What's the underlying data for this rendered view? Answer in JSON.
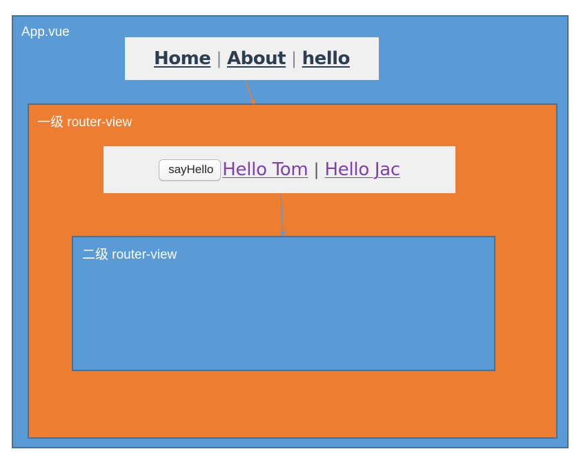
{
  "regions": {
    "app_label": "App.vue",
    "level1_label": "一级 router-view",
    "level2_label": "二级 router-view"
  },
  "top_nav": {
    "links": [
      "Home",
      "About",
      "hello"
    ],
    "separator": "|"
  },
  "sub_nav": {
    "button_label": "sayHello",
    "links": [
      "Hello Tom",
      "Hello Jac"
    ],
    "separator": "|"
  },
  "colors": {
    "app_bg": "#5b9bd5",
    "level1_bg": "#ed7d31",
    "level2_bg": "#5b9bd5",
    "border": "#41719c",
    "nav_panel_bg": "#f0f0f0",
    "top_link": "#2c3e50",
    "sub_link": "#7e3fb0",
    "arrow_orange": "#ed7d31",
    "arrow_blue": "#5b9bd5"
  }
}
